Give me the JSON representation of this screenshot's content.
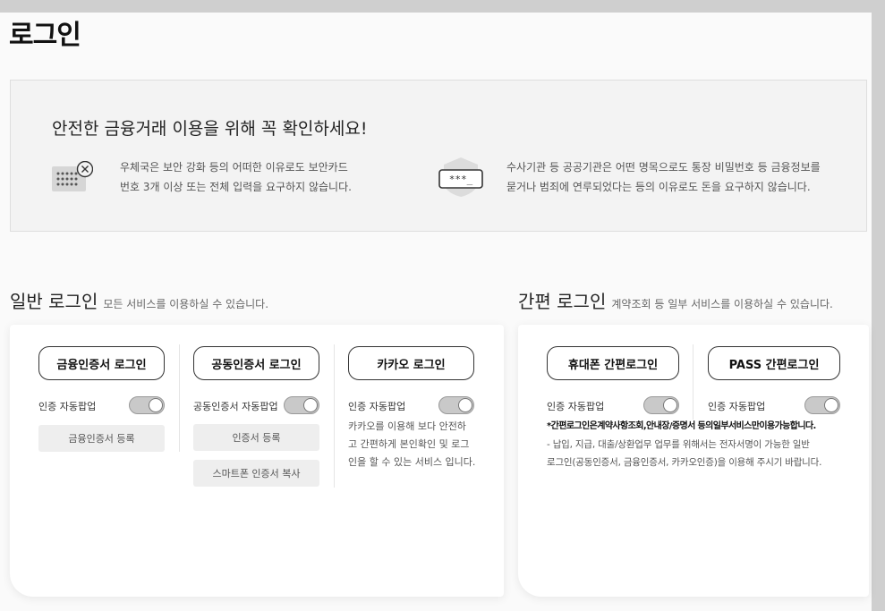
{
  "page_title": "로그인",
  "notice": {
    "title": "안전한 금융거래 이용을 위해 꼭 확인하세요!",
    "left_line1": "우체국은 보안 강화 등의 어떠한 이유로도 보안카드",
    "left_line2": "번호 3개 이상 또는 전체 입력을 요구하지 않습니다.",
    "right_line1": "수사기관 등 공공기관은 어떤 명목으로도 통장 비밀번호 등 금융정보를",
    "right_line2": "묻거나 범죄에 연루되었다는 등의 이유로도 돈을 요구하지 않습니다.",
    "shield_text": "***_"
  },
  "general": {
    "title": "일반 로그인",
    "subtitle": "모든 서비스를 이용하실 수 있습니다.",
    "col1": {
      "button": "금융인증서 로그인",
      "toggle_label": "인증 자동팝업",
      "sub_button": "금융인증서 등록"
    },
    "col2": {
      "button": "공동인증서 로그인",
      "toggle_label": "공동인증서 자동팝업",
      "sub_button1": "인증서 등록",
      "sub_button2": "스마트폰 인증서 복사"
    },
    "col3": {
      "button": "카카오 로그인",
      "toggle_label": "인증 자동팝업",
      "desc1": "카카오를 이용해 보다 안전하",
      "desc2": "고 간편하게 본인확인 및 로그",
      "desc3": "인을 할 수 있는 서비스 입니다."
    }
  },
  "simple": {
    "title": "간편 로그인",
    "subtitle": "계약조회 등 일부 서비스를 이용하실 수 있습니다.",
    "col1": {
      "button": "휴대폰 간편로그인",
      "toggle_label": "인증 자동팝업"
    },
    "col2": {
      "button": "PASS 간편로그인",
      "toggle_label": "인증 자동팝업"
    },
    "note_bold": "*간편로그인은계약사항조회,안내장/증명서 등의일부서비스만이용가능합니다.",
    "note1": "- 납입, 지급, 대출/상환업무 업무를 위해서는 전자서명이 가능한 일반",
    "note2": "로그인(공동인증서, 금융인증서, 카카오인증)을 이용해 주시기 바랍니다."
  }
}
